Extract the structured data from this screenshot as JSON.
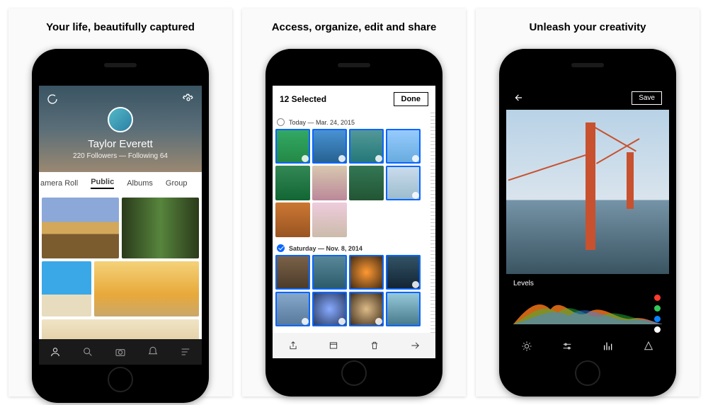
{
  "panels": [
    {
      "headline": "Your life, beautifully captured"
    },
    {
      "headline": "Access, organize, edit and share"
    },
    {
      "headline": "Unleash your creativity"
    }
  ],
  "profile": {
    "name": "Taylor Everett",
    "stats": "220 Followers — Following 64",
    "tabs": [
      "amera Roll",
      "Public",
      "Albums",
      "Group"
    ],
    "active_tab": 1
  },
  "bottom_nav_icons": [
    "person-icon",
    "search-icon",
    "camera-icon",
    "bell-icon",
    "list-icon"
  ],
  "selection": {
    "count_label": "12 Selected",
    "done": "Done",
    "groups": [
      {
        "label": "Today — Mar. 24, 2015",
        "checked": false
      },
      {
        "label": "Saturday — Nov. 8, 2014",
        "checked": true
      }
    ],
    "toolbar_icons": [
      "share-icon",
      "archive-icon",
      "trash-icon",
      "forward-icon"
    ]
  },
  "editor": {
    "save": "Save",
    "panel_label": "Levels",
    "dot_colors": [
      "#ff3b30",
      "#34c759",
      "#0a84ff",
      "#ffffff"
    ],
    "toolbar_icons": [
      "brightness-icon",
      "sliders-icon",
      "histogram-icon",
      "sharpen-icon"
    ]
  }
}
